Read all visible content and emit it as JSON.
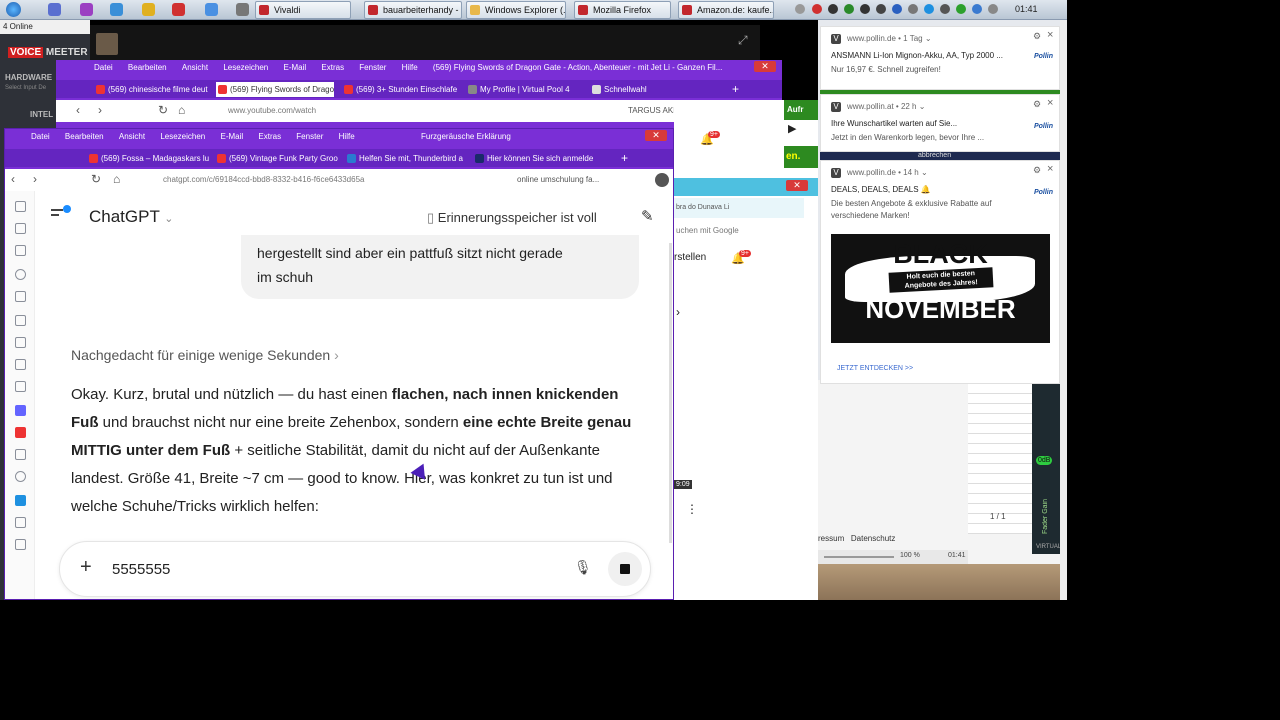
{
  "taskbar": {
    "tasks": [
      {
        "label": "Vivaldi"
      },
      {
        "label": "bauarbeiterhandy - ..."
      },
      {
        "label": "Windows Explorer (..."
      },
      {
        "label": "Mozilla Firefox"
      },
      {
        "label": "Amazon.de: kaufe..."
      }
    ],
    "clock": "01:41"
  },
  "status_online": "4 Online",
  "voicemeeter": {
    "logo_a": "VOICE",
    "logo_b": "MEETER",
    "hardware": "HARDWARE",
    "select": "Select Input De",
    "intel": "INTEL"
  },
  "yt_window": {
    "menu": [
      "Datei",
      "Bearbeiten",
      "Ansicht",
      "Lesezeichen",
      "E-Mail",
      "Extras",
      "Fenster",
      "Hilfe"
    ],
    "title": "(569) Flying Swords of Dragon Gate - Action, Abenteuer - mit Jet Li - Ganzen Fil...",
    "tabs": [
      {
        "label": "(569) chinesische filme deut"
      },
      {
        "label": "(569) Flying Swords of Drago"
      },
      {
        "label": "(569) 3+ Stunden Einschlafe"
      },
      {
        "label": "My Profile | Virtual Pool 4"
      },
      {
        "label": "Schnellwahl"
      }
    ],
    "url": "www.youtube.com/watch",
    "search": "TARGUS  AKB&",
    "badge": "9+"
  },
  "chat_window": {
    "menu": [
      "Datei",
      "Bearbeiten",
      "Ansicht",
      "Lesezeichen",
      "E-Mail",
      "Extras",
      "Fenster",
      "Hilfe"
    ],
    "title": "Furzgeräusche Erklärung",
    "tabs": [
      {
        "label": "(569) Fossa – Madagaskars lu"
      },
      {
        "label": "(569) Vintage Funk Party Groo"
      },
      {
        "label": "Helfen Sie mit, Thunderbird a"
      },
      {
        "label": "Hier können Sie sich anmelde"
      }
    ],
    "url": "chatgpt.com/c/69184ccd-bbd8-8332-b416-f6ce6433d65a",
    "search": "online umschulung fa..."
  },
  "chatgpt": {
    "app_title": "ChatGPT",
    "memory_notice": "Erinnerungsspeicher ist voll",
    "user_message_line1": "hergestellt sind aber ein pattfuß sitzt nicht gerade",
    "user_message_line2": "im schuh",
    "thought_label": "Nachgedacht für einige wenige Sekunden",
    "reply": [
      {
        "t": "Okay. Kurz, brutal und nützlich — du hast einen ",
        "b": false
      },
      {
        "t": "flachen, nach innen knickenden Fuß",
        "b": true
      },
      {
        "t": " und brauchst nicht nur eine breite Zehenbox, sondern ",
        "b": false
      },
      {
        "t": "eine echte Breite genau MITTIG unter dem Fuß",
        "b": true
      },
      {
        "t": " + seitliche Stabilität, damit du nicht auf der Außenkante landest. Größe 41, Breite ~7 cm — good to know. Hier, was konkret zu tun ist und welche Schuhe/Tricks wirklich helfen:",
        "b": false
      }
    ],
    "input_value": "5555555"
  },
  "mid_window": {
    "green_label_a": "Aufr",
    "green_label_b": "en.",
    "search_hint": "uchen mit Google",
    "tab_hint": "bra do Dunava Li",
    "button": "rstellen",
    "badge": "9+",
    "time": "9:09"
  },
  "notifications": [
    {
      "site": "www.pollin.de",
      "age": "1 Tag",
      "line1": "ANSMANN Li-Ion Mignon-Akku, AA, Typ 2000 ...",
      "line2": "Nur 16,97 €. Schnell zugreifen!"
    },
    {
      "site": "www.pollin.at",
      "age": "22 h",
      "line1": "Ihre Wunschartikel warten auf Sie...",
      "line2": "Jetzt in den Warenkorb legen, bevor Ihre ..."
    },
    {
      "site": "www.pollin.de",
      "age": "14 h",
      "line1": "DEALS, DEALS, DEALS",
      "line2": "Die besten Angebote & exklusive Rabatte auf",
      "line3": "verschiedene Marken!"
    }
  ],
  "pollin_logo": "Pollin",
  "abbrechen": "abbrechen",
  "promo": {
    "black": "BLACK",
    "sub1": "Holt euch die besten",
    "sub2": "Angebote des Jahres!",
    "november": "NOVEMBER",
    "cta": "JETZT ENTDECKEN >>"
  },
  "right_bottom": {
    "links_a": "ressum",
    "links_b": "Datenschutz",
    "zoom": "100 %",
    "time": "01:41",
    "page": "1 / 1",
    "fader": "Fader Gain",
    "db": "0dB",
    "virtual": "VIRTUAL"
  }
}
